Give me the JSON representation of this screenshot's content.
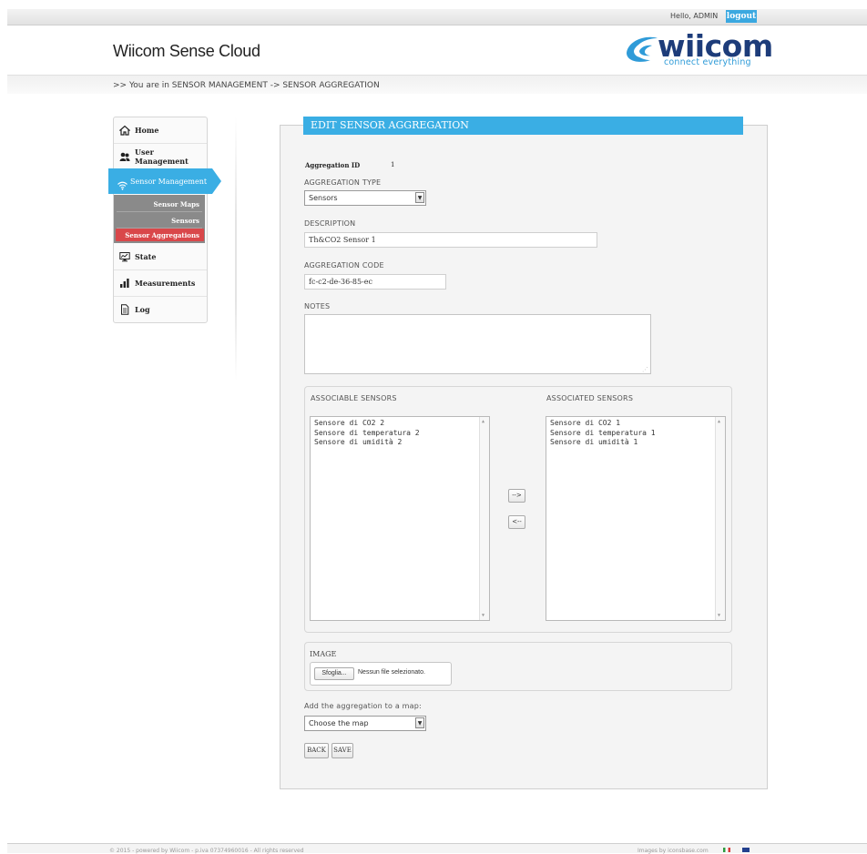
{
  "header": {
    "greeting": "Hello,",
    "username": "ADMIN",
    "logout_label": "logout",
    "app_title": "Wiicom Sense Cloud",
    "logo": {
      "word": "wiicom",
      "tagline": "connect everything",
      "icon": "wiicom-swoosh-icon"
    },
    "breadcrumb": ">> You are in SENSOR MANAGEMENT -> SENSOR AGGREGATION"
  },
  "sidebar": {
    "items": [
      {
        "label": "Home",
        "icon": "home-icon"
      },
      {
        "label": "User Management",
        "icon": "users-icon"
      },
      {
        "label": "Sensor Management",
        "icon": "wifi-icon",
        "active": true
      },
      {
        "label": "State",
        "icon": "monitor-icon"
      },
      {
        "label": "Measurements",
        "icon": "bar-chart-icon"
      },
      {
        "label": "Log",
        "icon": "document-icon"
      }
    ],
    "subitems": [
      {
        "label": "Sensor Maps"
      },
      {
        "label": "Sensors"
      },
      {
        "label": "Sensor Aggregations",
        "active": true
      }
    ]
  },
  "form": {
    "title": "EDIT SENSOR AGGREGATION",
    "aggregation_id_label": "Aggregation ID",
    "aggregation_id_value": "1",
    "type_label": "AGGREGATION TYPE",
    "type_value": "Sensors",
    "description_label": "DESCRIPTION",
    "description_value": "Th&CO2 Sensor 1",
    "code_label": "AGGREGATION CODE",
    "code_value": "fc-c2-de-36-85-ec",
    "notes_label": "NOTES",
    "notes_value": "",
    "associable_label": "ASSOCIABLE SENSORS",
    "associable": [
      "Sensore di CO2 2",
      "Sensore di temperatura 2",
      "Sensore di umidità 2"
    ],
    "associated_label": "ASSOCIATED SENSORS",
    "associated": [
      "Sensore di CO2 1",
      "Sensore di temperatura 1",
      "Sensore di umidità 1"
    ],
    "move_right": "-->",
    "move_left": "<--",
    "image_label": "IMAGE",
    "browse_label": "Sfoglia...",
    "file_status": "Nessun file selezionato.",
    "map_label": "Add the aggregation to a map:",
    "map_value": "Choose the map",
    "back_label": "BACK",
    "save_label": "SAVE"
  },
  "footer": {
    "left": "© 2015 - powered by Wiicom - p.iva 07374960016 - All rights reserved",
    "right": "Images by iconsbase.com"
  },
  "colors": {
    "accent": "#3aaee4",
    "active_sub": "#d9474a",
    "brand_dark": "#1d3c7a"
  }
}
